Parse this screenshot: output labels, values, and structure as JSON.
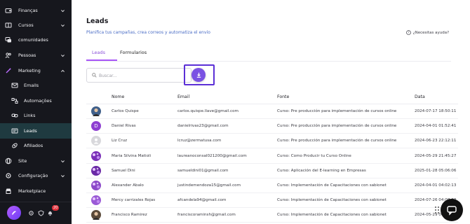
{
  "sidebar": {
    "items": [
      {
        "label": "Finanças",
        "icon": "wallet-icon",
        "chevron": "down"
      },
      {
        "label": "Cursos",
        "icon": "book-icon",
        "chevron": "down"
      },
      {
        "label": "comunidades",
        "icon": "chat-bubbles-icon",
        "chevron": ""
      },
      {
        "label": "Pessoas",
        "icon": "people-icon",
        "chevron": "down"
      },
      {
        "label": "Marketing",
        "icon": "wand-icon",
        "chevron": "up"
      },
      {
        "label": "Emails",
        "icon": "mail-icon",
        "chevron": ""
      },
      {
        "label": "Automações",
        "icon": "automation-icon",
        "chevron": ""
      },
      {
        "label": "Links",
        "icon": "link-icon",
        "chevron": ""
      },
      {
        "label": "Leads",
        "icon": "leads-icon",
        "chevron": ""
      },
      {
        "label": "Afiliados",
        "icon": "affiliate-icon",
        "chevron": ""
      },
      {
        "label": "Site",
        "icon": "globe-icon",
        "chevron": "down"
      },
      {
        "label": "Configuração",
        "icon": "gear-icon",
        "chevron": "down"
      },
      {
        "label": "Marketplace",
        "icon": "store-icon",
        "chevron": ""
      }
    ],
    "notification_count": "20"
  },
  "page": {
    "title": "Leads",
    "subtitle": "Planifica tus campañas, crea correos y automatiza el envío",
    "help": "¿Necesitas ayuda?"
  },
  "tabs": [
    {
      "label": "Leads",
      "active": true
    },
    {
      "label": "Formularios",
      "active": false
    }
  ],
  "search": {
    "placeholder": "Buscar..."
  },
  "table": {
    "columns": [
      "Nome",
      "Email",
      "Fonte",
      "Data"
    ],
    "rows": [
      {
        "name": "Carlos Quispe",
        "email": "carlos.quispe.llave@gmail.com",
        "source": "Curso: Pre producción para implementación de cursos online",
        "date": "2024-07-17 18:50:11",
        "avatar": {
          "type": "photo",
          "color": "#3f5f8a"
        }
      },
      {
        "name": "Daniel Rivas",
        "email": "danielrivas23@gmail.com",
        "source": "Curso: Pre producción para implementación de cursos online",
        "date": "2024-04-01 01:52:41",
        "avatar": {
          "type": "letter",
          "letter": "D",
          "color": "#8e3fd1"
        }
      },
      {
        "name": "Liz Cruz",
        "email": "lcruz@zermatusa.com",
        "source": "Curso: Pre producción para implementación de cursos online",
        "date": "2024-06-23 22:12:11",
        "avatar": {
          "type": "placeholder",
          "color": "#d8d8dc"
        }
      },
      {
        "name": "Maria Silvina Matioli",
        "email": "laureanoconsal021200@gmail.com",
        "source": "Curso: Como Producir tu Curso Online",
        "date": "2024-05-29 21:45:27",
        "avatar": {
          "type": "pattern",
          "color": "#7a2fb8"
        }
      },
      {
        "name": "Samuel Dini",
        "email": "samueldini01@gmail.com",
        "source": "Curso: Aplicación del E-learning en Empresas",
        "date": "2025-01-28 05:06:06",
        "avatar": {
          "type": "pattern",
          "color": "#6a2aa6"
        }
      },
      {
        "name": "Alexander Abalo",
        "email": "justindemendoza15@gmail.com",
        "source": "Curso: Implementación de Capacitaciones con sabionet",
        "date": "2024-04-01 04:02:13",
        "avatar": {
          "type": "pattern",
          "color": "#8b49c9"
        }
      },
      {
        "name": "Mercy carrizales Rojas",
        "email": "afcandela94@gmail.com",
        "source": "Curso: Implementación de Capacitaciones con sabionet",
        "date": "2024-07-26 04:08:03",
        "avatar": {
          "type": "pattern",
          "color": "#9a5ad6"
        }
      },
      {
        "name": "Francisco Ramirez",
        "email": "franciscoraminsh@gmail.com",
        "source": "Curso: Implementación de Capacitaciones con sabionet",
        "date": "2024-05-29 00:55:03",
        "avatar": {
          "type": "photo",
          "color": "#5a4a3a"
        }
      }
    ]
  },
  "colors": {
    "accent": "#8a4fd8",
    "sidebar_bg": "#16171d",
    "active_item_bg": "#1f3a40",
    "highlight_border": "#5b2fd6"
  }
}
